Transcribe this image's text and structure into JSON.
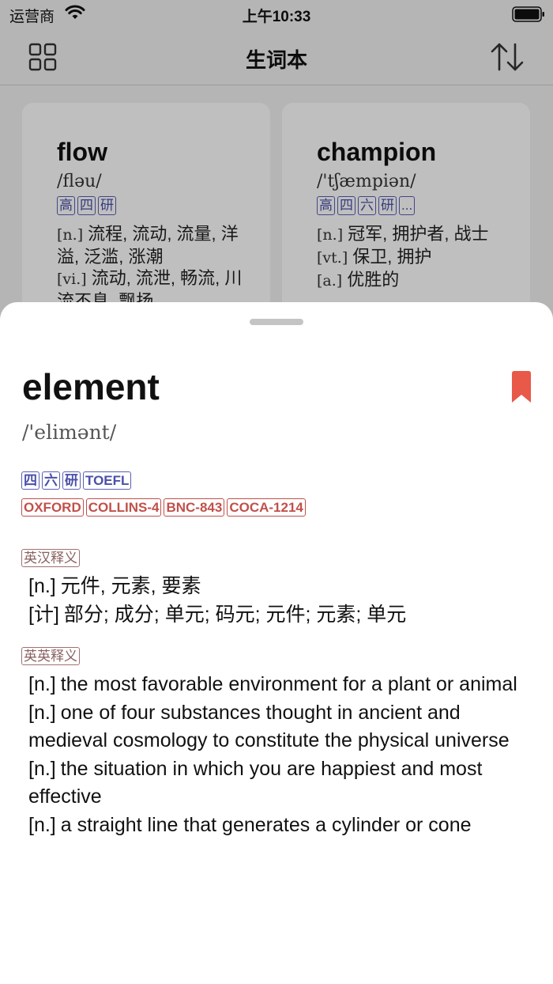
{
  "status_bar": {
    "carrier": "运营商",
    "time": "上午10:33"
  },
  "nav": {
    "title": "生词本"
  },
  "cards": [
    {
      "word": "flow",
      "phonetic": "/fləu/",
      "tags": [
        "高",
        "四",
        "研"
      ],
      "defs": [
        {
          "pos": "[n.]",
          "text": "流程, 流动, 流量, 洋溢, 泛滥, 涨潮"
        },
        {
          "pos": "[vi.]",
          "text": "流动, 流泄, 畅流, 川流不息, 飘扬"
        }
      ]
    },
    {
      "word": "champion",
      "phonetic": "/'tʃæmpiən/",
      "tags": [
        "高",
        "四",
        "六",
        "研",
        "..."
      ],
      "defs": [
        {
          "pos": "[n.]",
          "text": "冠军, 拥护者, 战士"
        },
        {
          "pos": "[vt.]",
          "text": "保卫, 拥护"
        },
        {
          "pos": "[a.]",
          "text": "优胜的"
        }
      ]
    }
  ],
  "detail": {
    "word": "element",
    "phonetic": "/'elimənt/",
    "exam_tags": [
      "四",
      "六",
      "研",
      "TOEFL"
    ],
    "corpus_tags": [
      "OXFORD",
      "COLLINS-4",
      "BNC-843",
      "COCA-1214"
    ],
    "cn_label": "英汉释义",
    "cn_defs": [
      {
        "pos": "[n.]",
        "text": "元件, 元素, 要素"
      },
      {
        "pos": "[计]",
        "text": "部分; 成分; 单元; 码元; 元件; 元素; 单元"
      }
    ],
    "en_label": "英英释义",
    "en_defs": [
      {
        "pos": "[n.]",
        "text": "the most favorable environment for a plant or animal"
      },
      {
        "pos": "[n.]",
        "text": "one of four substances thought in ancient and medieval cosmology to constitute the physical universe"
      },
      {
        "pos": "[n.]",
        "text": "the situation in which you are happiest and most effective"
      },
      {
        "pos": "[n.]",
        "text": "a straight line that generates a cylinder or cone"
      }
    ]
  },
  "colors": {
    "bookmark": "#e8594a",
    "exam_tag": "#4a4fa8",
    "corpus_tag": "#c0504a"
  }
}
